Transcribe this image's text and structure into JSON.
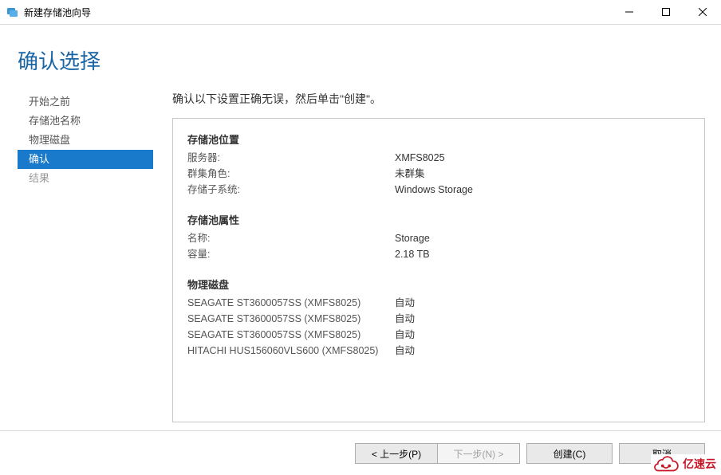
{
  "window": {
    "title": "新建存储池向导"
  },
  "heading": "确认选择",
  "sidebar": {
    "items": [
      {
        "label": "开始之前"
      },
      {
        "label": "存储池名称"
      },
      {
        "label": "物理磁盘"
      },
      {
        "label": "确认"
      },
      {
        "label": "结果"
      }
    ],
    "active_index": 3
  },
  "main": {
    "instruction": "确认以下设置正确无误，然后单击\"创建\"。",
    "sections": {
      "location": {
        "title": "存储池位置",
        "rows": [
          {
            "k": "服务器:",
            "v": "XMFS8025"
          },
          {
            "k": "群集角色:",
            "v": "未群集"
          },
          {
            "k": "存储子系统:",
            "v": "Windows Storage"
          }
        ]
      },
      "properties": {
        "title": "存储池属性",
        "rows": [
          {
            "k": "名称:",
            "v": "Storage"
          },
          {
            "k": "容量:",
            "v": "2.18 TB"
          }
        ]
      },
      "disks": {
        "title": "物理磁盘",
        "rows": [
          {
            "k": "SEAGATE ST3600057SS (XMFS8025)",
            "v": "自动"
          },
          {
            "k": "SEAGATE ST3600057SS (XMFS8025)",
            "v": "自动"
          },
          {
            "k": "SEAGATE ST3600057SS (XMFS8025)",
            "v": "自动"
          },
          {
            "k": "HITACHI HUS156060VLS600 (XMFS8025)",
            "v": "自动"
          }
        ]
      }
    }
  },
  "footer": {
    "prev": "< 上一步(P)",
    "next": "下一步(N) >",
    "create": "创建(C)",
    "cancel": "取消"
  },
  "watermark": "亿速云"
}
